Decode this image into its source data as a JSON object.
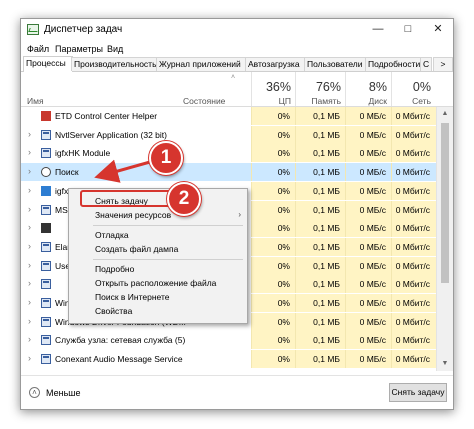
{
  "window": {
    "title": "Диспетчер задач"
  },
  "menu": [
    "Файл",
    "Параметры",
    "Вид"
  ],
  "tabs": [
    "Процессы",
    "Производительность",
    "Журнал приложений",
    "Автозагрузка",
    "Пользователи",
    "Подробности",
    "С"
  ],
  "columns": {
    "name": "Имя",
    "status": "Состояние",
    "cpu": {
      "pct": "36%",
      "label": "ЦП"
    },
    "memory": {
      "pct": "76%",
      "label": "Память"
    },
    "disk": {
      "pct": "8%",
      "label": "Диск"
    },
    "network": {
      "pct": "0%",
      "label": "Сеть"
    }
  },
  "processes": [
    {
      "name": "ETD Control Center Helper",
      "cpu": "0%",
      "mem": "0,1 МБ",
      "disk": "0 МБ/с",
      "net": "0 Мбит/с",
      "icon": "red-app-icon"
    },
    {
      "name": "NvtlServer Application (32 bit)",
      "cpu": "0%",
      "mem": "0,1 МБ",
      "disk": "0 МБ/с",
      "net": "0 Мбит/с",
      "icon": "window-app-icon"
    },
    {
      "name": "igfxHK Module",
      "cpu": "0%",
      "mem": "0,1 МБ",
      "disk": "0 МБ/с",
      "net": "0 Мбит/с",
      "icon": "window-app-icon"
    },
    {
      "name": "Поиск",
      "cpu": "0%",
      "mem": "0,1 МБ",
      "disk": "0 МБ/с",
      "net": "0 Мбит/с",
      "icon": "search-icon"
    },
    {
      "name": "igfxT",
      "cpu": "0%",
      "mem": "0,1 МБ",
      "disk": "0 МБ/с",
      "net": "0 Мбит/с",
      "icon": "blue-app-icon"
    },
    {
      "name": "MSS",
      "cpu": "0%",
      "mem": "0,1 МБ",
      "disk": "0 МБ/с",
      "net": "0 Мбит/с",
      "icon": "window-app-icon"
    },
    {
      "name": "",
      "cpu": "0%",
      "mem": "0,1 МБ",
      "disk": "0 МБ/с",
      "net": "0 Мбит/с",
      "icon": "console-icon"
    },
    {
      "name": "Elan",
      "cpu": "0%",
      "mem": "0,1 МБ",
      "disk": "0 МБ/с",
      "net": "0 Мбит/с",
      "icon": "window-app-icon"
    },
    {
      "name": "User",
      "cpu": "0%",
      "mem": "0,1 МБ",
      "disk": "0 МБ/с",
      "net": "0 Мбит/с",
      "icon": "window-app-icon"
    },
    {
      "name": "",
      "cpu": "0%",
      "mem": "0,1 МБ",
      "disk": "0 МБ/с",
      "net": "0 Мбит/с",
      "icon": "window-app-icon"
    },
    {
      "name": "Wind",
      "cpu": "0%",
      "mem": "0,1 МБ",
      "disk": "0 МБ/с",
      "net": "0 Мбит/с",
      "icon": "window-app-icon"
    },
    {
      "name": "Windows Driver Foundation (WD...",
      "cpu": "0%",
      "mem": "0,1 МБ",
      "disk": "0 МБ/с",
      "net": "0 Мбит/с",
      "icon": "window-app-icon"
    },
    {
      "name": "Служба узла: сетевая служба (5)",
      "cpu": "0%",
      "mem": "0,1 МБ",
      "disk": "0 МБ/с",
      "net": "0 Мбит/с",
      "icon": "gear-icon"
    },
    {
      "name": "Conexant Audio Message Service",
      "cpu": "0%",
      "mem": "0,1 МБ",
      "disk": "0 МБ/с",
      "net": "0 Мбит/с",
      "icon": "window-app-icon"
    }
  ],
  "context_menu": {
    "items": [
      "Снять задачу",
      "Значения ресурсов",
      "Отладка",
      "Создать файл дампа",
      "Подробно",
      "Открыть расположение файла",
      "Поиск в Интернете",
      "Свойства"
    ]
  },
  "footer": {
    "less": "Меньше",
    "end_task": "Снять задачу"
  },
  "badges": [
    "1",
    "2"
  ],
  "colors": {
    "highlight": "#cce8ff",
    "heat": "#fff4c4",
    "annotation": "#d6352e"
  }
}
